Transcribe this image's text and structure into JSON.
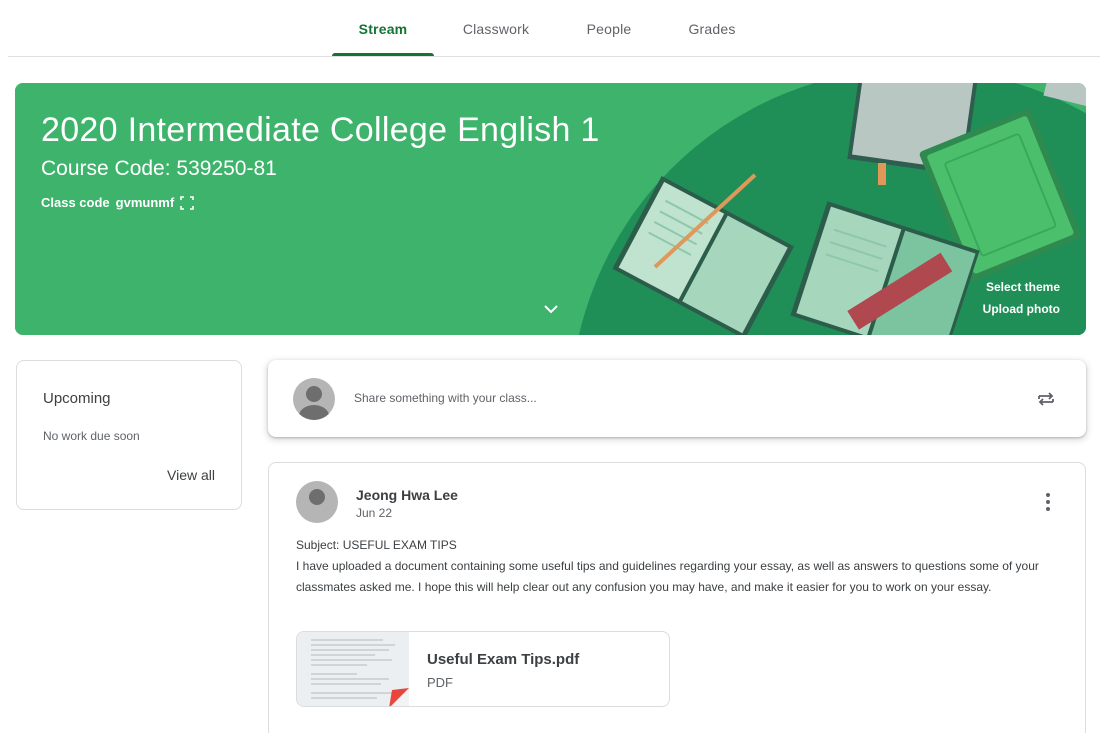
{
  "tabs": [
    {
      "label": "Stream",
      "active": true
    },
    {
      "label": "Classwork",
      "active": false
    },
    {
      "label": "People",
      "active": false
    },
    {
      "label": "Grades",
      "active": false
    }
  ],
  "banner": {
    "title": "2020 Intermediate College English 1",
    "course_code": "Course Code: 539250-81",
    "class_code_label": "Class code",
    "class_code_value": "gvmunmf",
    "select_theme": "Select theme",
    "upload_photo": "Upload photo",
    "color": "#3db36b"
  },
  "upcoming": {
    "heading": "Upcoming",
    "empty_text": "No work due soon",
    "view_all": "View all"
  },
  "share": {
    "placeholder": "Share something with your class..."
  },
  "post": {
    "author": "Jeong Hwa Lee",
    "date": "Jun 22",
    "subject": "Subject: USEFUL EXAM TIPS",
    "body": "I have uploaded a document containing some useful tips and guidelines regarding your essay, as well as answers to questions some of your classmates asked me. I hope this will help clear out any confusion you may have, and make it easier for you to work on your essay.",
    "attachment": {
      "name": "Useful Exam Tips.pdf",
      "type": "PDF"
    }
  },
  "colors": {
    "accent": "#137333",
    "banner": "#3db36b",
    "banner_dark": "#1e8e50"
  },
  "icons": {
    "class_code": "fullscreen-icon",
    "banner_expand": "chevron-down-icon",
    "share": "repost-icon",
    "post_menu": "more-vert-icon"
  }
}
